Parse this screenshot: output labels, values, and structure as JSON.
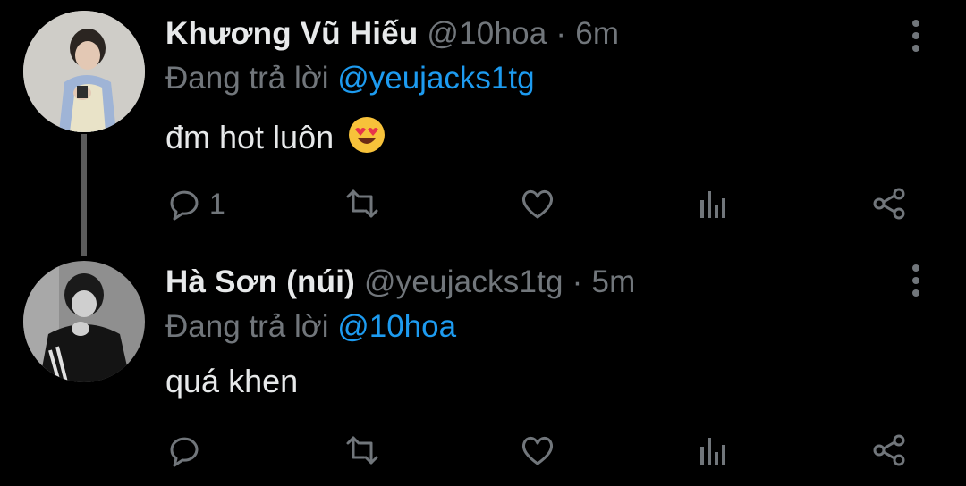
{
  "tweets": [
    {
      "name": "Khương Vũ Hiếu",
      "handle": "@10hoa",
      "separator": "·",
      "time": "6m",
      "replying_prefix": "Đang trả lời",
      "replying_to": "@yeujacks1tg",
      "text": "đm hot luôn",
      "emoji": "heart-eyes-emoji",
      "reply_count": "1"
    },
    {
      "name": "Hà Sơn (núi)",
      "handle": "@yeujacks1tg",
      "separator": "·",
      "time": "5m",
      "replying_prefix": "Đang trả lời",
      "replying_to": "@10hoa",
      "text": "quá khen",
      "reply_count": ""
    }
  ],
  "icons": {
    "reply": "reply-icon",
    "retweet": "retweet-icon",
    "like": "heart-icon",
    "analytics": "analytics-icon",
    "share": "share-icon",
    "more": "more-vertical-icon"
  },
  "colors": {
    "background": "#000000",
    "text_primary": "#e7e9ea",
    "text_secondary": "#71767b",
    "link": "#1d9bf0",
    "thread_line": "#5b5b5b"
  }
}
